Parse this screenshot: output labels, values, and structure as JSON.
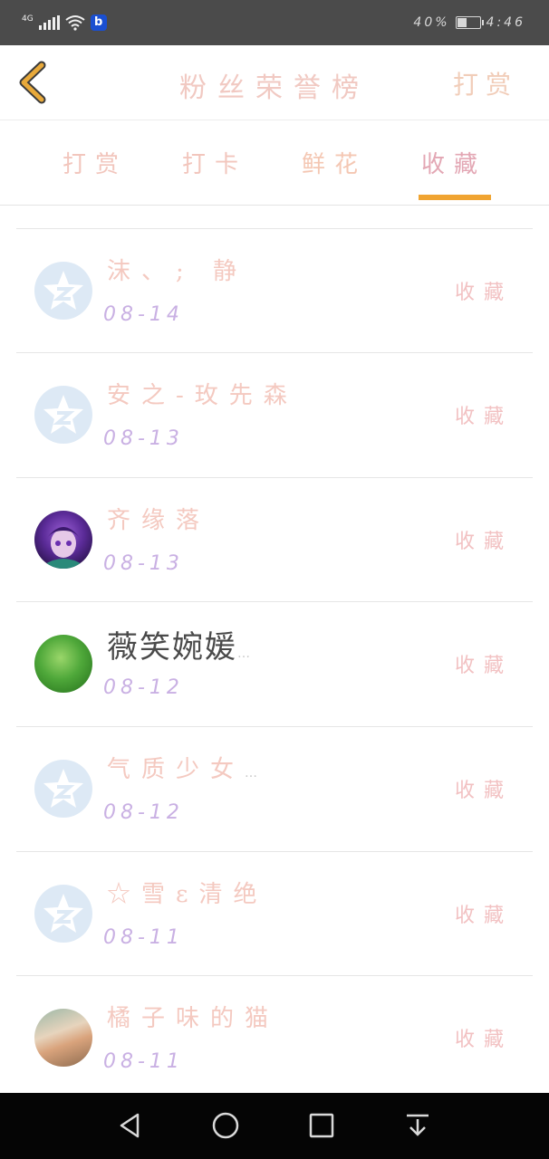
{
  "status_bar": {
    "network": "4G",
    "app_badge": "b",
    "battery": "40%",
    "time": "4:46"
  },
  "header": {
    "title": "粉丝荣誉榜",
    "action": "打赏"
  },
  "tabs": [
    {
      "label": "打赏"
    },
    {
      "label": "打卡"
    },
    {
      "label": "鲜花"
    },
    {
      "label": "收藏",
      "active": true
    }
  ],
  "list": [
    {
      "name": "沫、; 静",
      "date": "08-14",
      "action": "收藏",
      "avatar": "default"
    },
    {
      "name": "安之-玫先森",
      "date": "08-13",
      "action": "收藏",
      "avatar": "default"
    },
    {
      "name": "齐缘落",
      "date": "08-13",
      "action": "收藏",
      "avatar": "anime"
    },
    {
      "name": "薇笑婉媛",
      "ellipsis": "…",
      "date": "08-12",
      "action": "收藏",
      "avatar": "green"
    },
    {
      "name": "气质少女",
      "ellipsis": "…",
      "date": "08-12",
      "action": "收藏",
      "avatar": "default"
    },
    {
      "name": "☆雪ε清绝",
      "date": "08-11",
      "action": "收藏",
      "avatar": "default"
    },
    {
      "name": "橘子味的猫",
      "date": "08-11",
      "action": "收藏",
      "avatar": "photo"
    }
  ],
  "colors": {
    "tab_indicator": "#f0a431",
    "back_arrow": "#e8a93a",
    "status_bar_bg": "#4b4b4b",
    "nav_bar_bg": "#050505"
  },
  "icons": {
    "back": "chevron-left-icon",
    "default_avatar": "qzone-star-icon",
    "nav_back": "triangle-back-icon",
    "nav_home": "circle-home-icon",
    "nav_recents": "square-recents-icon",
    "nav_notifications": "pull-down-icon"
  }
}
